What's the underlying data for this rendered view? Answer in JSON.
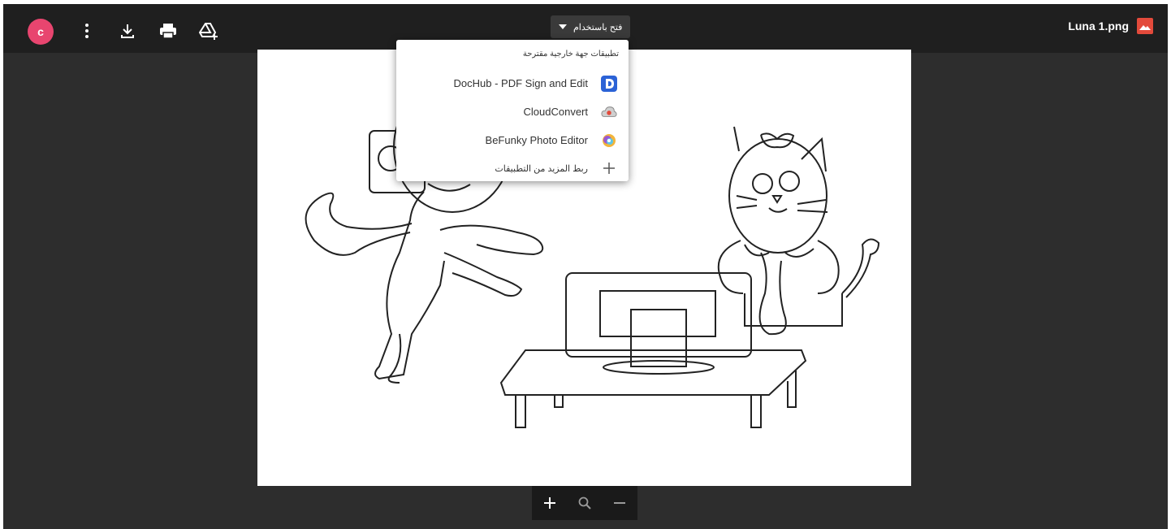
{
  "header": {
    "avatar_letter": "c",
    "file_name": "Luna 1.png",
    "open_with_label": "فتح باستخدام",
    "icons": [
      "more-vert-icon",
      "download-icon",
      "print-icon",
      "add-to-drive-icon"
    ]
  },
  "open_with_menu": {
    "header": "تطبيقات جهة خارجية مقترحة",
    "items": [
      {
        "label": "DocHub - PDF Sign and Edit",
        "icon": "dochub-icon"
      },
      {
        "label": "CloudConvert",
        "icon": "cloudconvert-icon"
      },
      {
        "label": "BeFunky Photo Editor",
        "icon": "befunky-icon"
      }
    ],
    "more_apps_label": "ربط المزيد من التطبيقات"
  },
  "zoom": {
    "icons": [
      "zoom-in-icon",
      "zoom-reset-icon",
      "zoom-out-icon"
    ]
  },
  "colors": {
    "avatar": "#e8456f",
    "file_icon": "#e34a3b",
    "dochub": "#2b62d6",
    "topbar": "#1f1f1f",
    "viewer_bg": "#2d2d2d"
  }
}
